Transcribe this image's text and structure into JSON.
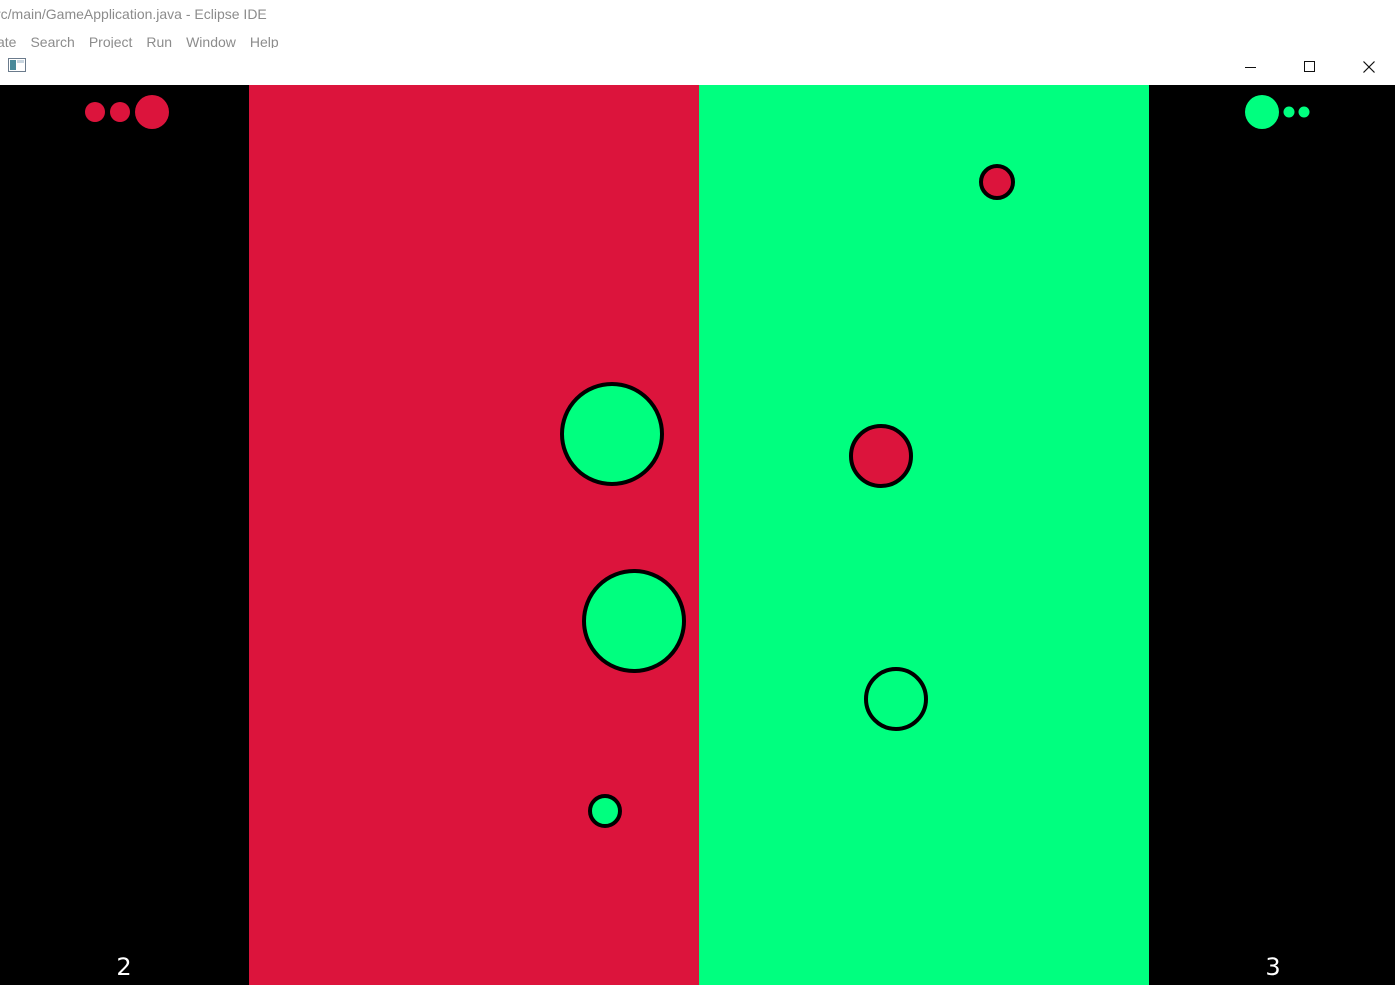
{
  "ide": {
    "title": "rc/main/GameApplication.java - Eclipse IDE",
    "menu": [
      "ate",
      "Search",
      "Project",
      "Run",
      "Window",
      "Help"
    ]
  },
  "window": {
    "icon": "java-app-icon",
    "controls": {
      "minimize_icon": "minimize-icon",
      "maximize_icon": "maximize-icon",
      "close_icon": "close-icon"
    }
  },
  "game": {
    "colors": {
      "red": "#dc143c",
      "green": "#00ff7f",
      "black": "#000000",
      "outline": "#000000"
    },
    "left_player": {
      "color": "red",
      "score": "2",
      "lives_indicator": [
        "small",
        "small",
        "large"
      ]
    },
    "right_player": {
      "color": "green",
      "score": "3",
      "lives_indicator": [
        "large",
        "small",
        "small"
      ]
    },
    "balls": [
      {
        "side": "red-field",
        "color": "green",
        "size": "large"
      },
      {
        "side": "red-field",
        "color": "green",
        "size": "large"
      },
      {
        "side": "red-field",
        "color": "green",
        "size": "small"
      },
      {
        "side": "green-field",
        "color": "red",
        "size": "small"
      },
      {
        "side": "green-field",
        "color": "red",
        "size": "medium"
      },
      {
        "side": "green-field",
        "color": "green",
        "size": "medium"
      }
    ]
  }
}
